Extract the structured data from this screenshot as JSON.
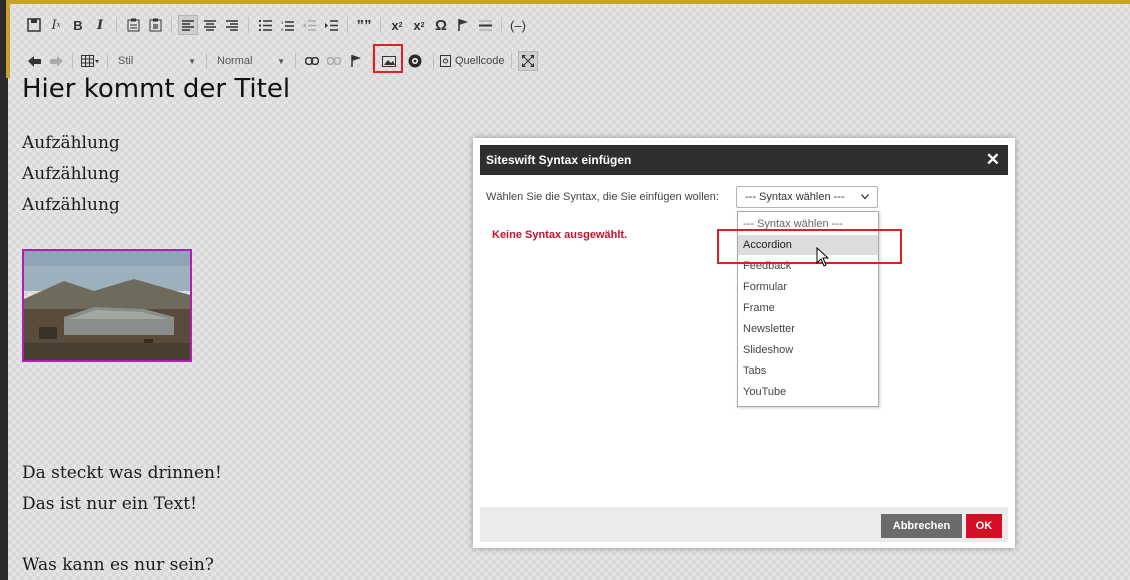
{
  "toolbar": {
    "style_combo": "Stil",
    "format_combo": "Normal",
    "source_label": "Quellcode"
  },
  "editor": {
    "title": "Hier kommt der Titel",
    "list_items": [
      "Aufzählung",
      "Aufzählung",
      "Aufzählung"
    ],
    "paragraph_1": "Da steckt was drinnen!",
    "paragraph_2": "Das ist nur ein Text!",
    "paragraph_3": "Was kann es nur sein?"
  },
  "dialog": {
    "title": "Siteswift Syntax einfügen",
    "close": "✕",
    "label": "Wählen Sie die Syntax, die Sie einfügen wollen:",
    "select_value": "--- Syntax wählen ---",
    "error": "Keine Syntax ausgewählt.",
    "cancel": "Abbrechen",
    "ok": "OK"
  },
  "dropdown": {
    "options": [
      "--- Syntax wählen ---",
      "Accordion",
      "Feedback",
      "Formular",
      "Frame",
      "Newsletter",
      "Slideshow",
      "Tabs",
      "YouTube"
    ],
    "highlighted": "Accordion"
  },
  "colors": {
    "accent_gold": "#c9a227",
    "dialog_header": "#2f2f2f",
    "ok_red": "#d50f25",
    "error_red": "#c8102e",
    "highlight_red": "#e02020",
    "image_border": "#b01eb0"
  }
}
